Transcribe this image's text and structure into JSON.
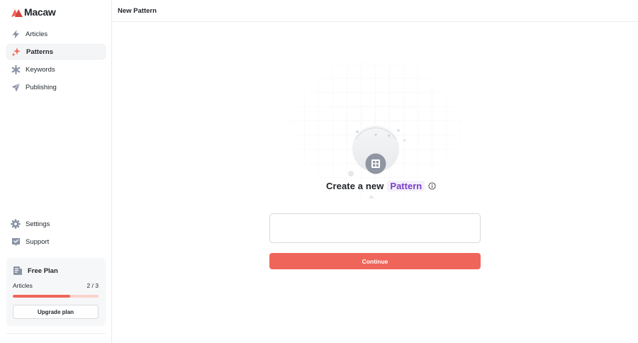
{
  "app": {
    "name": "Macaw",
    "logo_icon": "macaw-logo-icon",
    "accent_color": "#f0655a"
  },
  "sidebar": {
    "items": [
      {
        "label": "Articles",
        "icon": "bolt-icon",
        "active": false
      },
      {
        "label": "Patterns",
        "icon": "sparkles-icon",
        "active": true
      },
      {
        "label": "Keywords",
        "icon": "asterisk-icon",
        "active": false
      },
      {
        "label": "Publishing",
        "icon": "send-icon",
        "active": false
      }
    ],
    "bottom_items": [
      {
        "label": "Settings",
        "icon": "gear-icon"
      },
      {
        "label": "Support",
        "icon": "support-icon"
      }
    ],
    "plan": {
      "title": "Free Plan",
      "icon": "plan-icon",
      "usage_label": "Articles",
      "usage_count": "2 / 3",
      "usage_fraction": 0.67,
      "upgrade_label": "Upgrade plan"
    }
  },
  "header": {
    "title": "New Pattern"
  },
  "main": {
    "heading": "Create a new",
    "heading_accent": "Pattern",
    "heading_accent_color": "#7a3fc8",
    "info_icon": "info-icon",
    "illustration_icon": "pattern-grid-icon",
    "input_value": "",
    "continue_label": "Continue"
  }
}
